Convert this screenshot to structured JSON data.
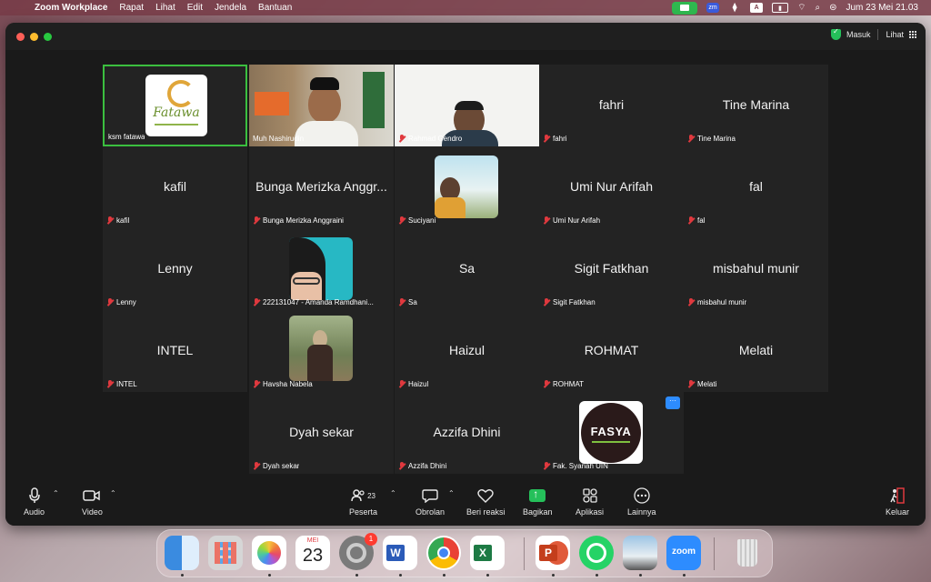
{
  "menubar": {
    "app_name": "Zoom Workplace",
    "menus": [
      "Rapat",
      "Lihat",
      "Edit",
      "Jendela",
      "Bantuan"
    ],
    "clock": "Jum 23 Mei  21.03",
    "zm_label": "zm",
    "input_label": "A"
  },
  "titlebar": {
    "signin": "Masuk",
    "view": "Lihat"
  },
  "participants": [
    {
      "name": "ksm fatawa",
      "display": "",
      "type": "logo"
    },
    {
      "name": "Muh Nashirudin",
      "display": "",
      "type": "video"
    },
    {
      "name": "Rahmad Gendro",
      "display": "",
      "type": "video"
    },
    {
      "name": "fahri",
      "display": "fahri",
      "type": "name"
    },
    {
      "name": "Tine Marina",
      "display": "Tine Marina",
      "type": "name"
    },
    {
      "name": "kafil",
      "display": "kafil",
      "type": "name"
    },
    {
      "name": "Bunga Merizka Anggraini",
      "display": "Bunga Merizka Anggr...",
      "type": "name"
    },
    {
      "name": "Suciyani",
      "display": "",
      "type": "avatar"
    },
    {
      "name": "Umi Nur Arifah",
      "display": "Umi Nur Arifah",
      "type": "name"
    },
    {
      "name": "fal",
      "display": "fal",
      "type": "name"
    },
    {
      "name": "Lenny",
      "display": "Lenny",
      "type": "name"
    },
    {
      "name": "222131047 - Amanda Ramdhani...",
      "display": "",
      "type": "avatar"
    },
    {
      "name": "Sa",
      "display": "Sa",
      "type": "name"
    },
    {
      "name": "Sigit Fatkhan",
      "display": "Sigit Fatkhan",
      "type": "name"
    },
    {
      "name": "misbahul munir",
      "display": "misbahul munir",
      "type": "name"
    },
    {
      "name": "INTEL",
      "display": "INTEL",
      "type": "name"
    },
    {
      "name": "Havsha Nabela",
      "display": "",
      "type": "avatar"
    },
    {
      "name": "Haizul",
      "display": "Haizul",
      "type": "name"
    },
    {
      "name": "ROHMAT",
      "display": "ROHMAT",
      "type": "name"
    },
    {
      "name": "Melati",
      "display": "Melati",
      "type": "name"
    },
    {
      "name": "Dyah sekar",
      "display": "Dyah sekar",
      "type": "name"
    },
    {
      "name": "Azzifa Dhini",
      "display": "Azzifa Dhini",
      "type": "name"
    },
    {
      "name": "Fak. Syariah UIN",
      "display": "",
      "type": "logo"
    }
  ],
  "logos": {
    "fatawa": "Fatawa",
    "fasya": "FASYA"
  },
  "toolbar": {
    "audio": "Audio",
    "video": "Video",
    "participants": "Peserta",
    "participant_count": "23",
    "chat": "Obrolan",
    "reactions": "Beri reaksi",
    "share": "Bagikan",
    "apps": "Aplikasi",
    "more": "Lainnya",
    "leave": "Keluar"
  },
  "dock": {
    "calendar_month": "MEI",
    "calendar_day": "23",
    "settings_badge": "1",
    "word_letter": "W",
    "excel_letter": "X",
    "ppt_letter": "P",
    "zoom_label": "zoom"
  },
  "colors": {
    "active_speaker_border": "#3bbf3f",
    "muted_mic": "#e0393e",
    "share_green": "#25c05a",
    "zoom_blue": "#2d8cff"
  }
}
